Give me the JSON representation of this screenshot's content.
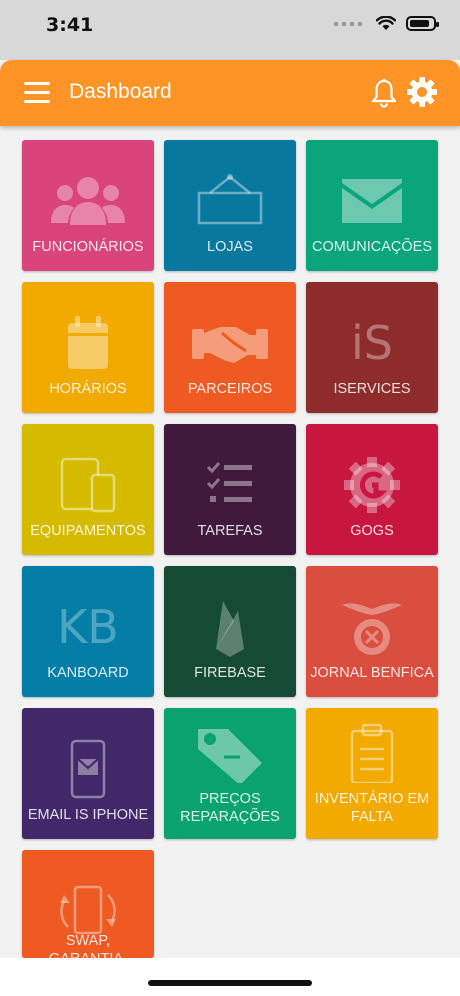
{
  "status": {
    "time": "3:41"
  },
  "appbar": {
    "title": "Dashboard"
  },
  "tiles": [
    {
      "label": "FUNCIONÁRIOS",
      "color": "#d9447a",
      "icon": "people-icon"
    },
    {
      "label": "LOJAS",
      "color": "#08789e",
      "icon": "sign-icon"
    },
    {
      "label": "COMUNICAÇÕES",
      "color": "#0aa57a",
      "icon": "envelope-icon"
    },
    {
      "label": "HORÁRIOS",
      "color": "#f2a900",
      "icon": "calendar-icon"
    },
    {
      "label": "PARCEIROS",
      "color": "#ee5a22",
      "icon": "handshake-icon"
    },
    {
      "label": "ISERVICES",
      "color": "#8e2b2b",
      "icon": "is-logo-icon",
      "icon_text": "iS"
    },
    {
      "label": "EQUIPAMENTOS",
      "color": "#d4bb00",
      "icon": "devices-icon"
    },
    {
      "label": "TAREFAS",
      "color": "#3f1a3d",
      "icon": "checklist-icon"
    },
    {
      "label": "GOGS",
      "color": "#c7163f",
      "icon": "gogs-gear-icon"
    },
    {
      "label": "KANBOARD",
      "color": "#047ea6",
      "icon": "kb-logo-icon",
      "icon_text": "KB"
    },
    {
      "label": "FIREBASE",
      "color": "#154a35",
      "icon": "firebase-icon"
    },
    {
      "label": "JORNAL BENFICA",
      "color": "#d94e3e",
      "icon": "benfica-crest-icon"
    },
    {
      "label": "EMAIL IS IPHONE",
      "color": "#422868",
      "icon": "phone-mail-icon"
    },
    {
      "label": "PREÇOS REPARAÇÕES",
      "color": "#0aa36f",
      "icon": "price-tag-icon"
    },
    {
      "label": "INVENTÁRIO EM FALTA",
      "color": "#f2a900",
      "icon": "clipboard-icon"
    },
    {
      "label": "SWAP, GARANTIA, ORÇAMENTO",
      "color": "#ee5a22",
      "icon": "phone-swap-icon"
    }
  ]
}
